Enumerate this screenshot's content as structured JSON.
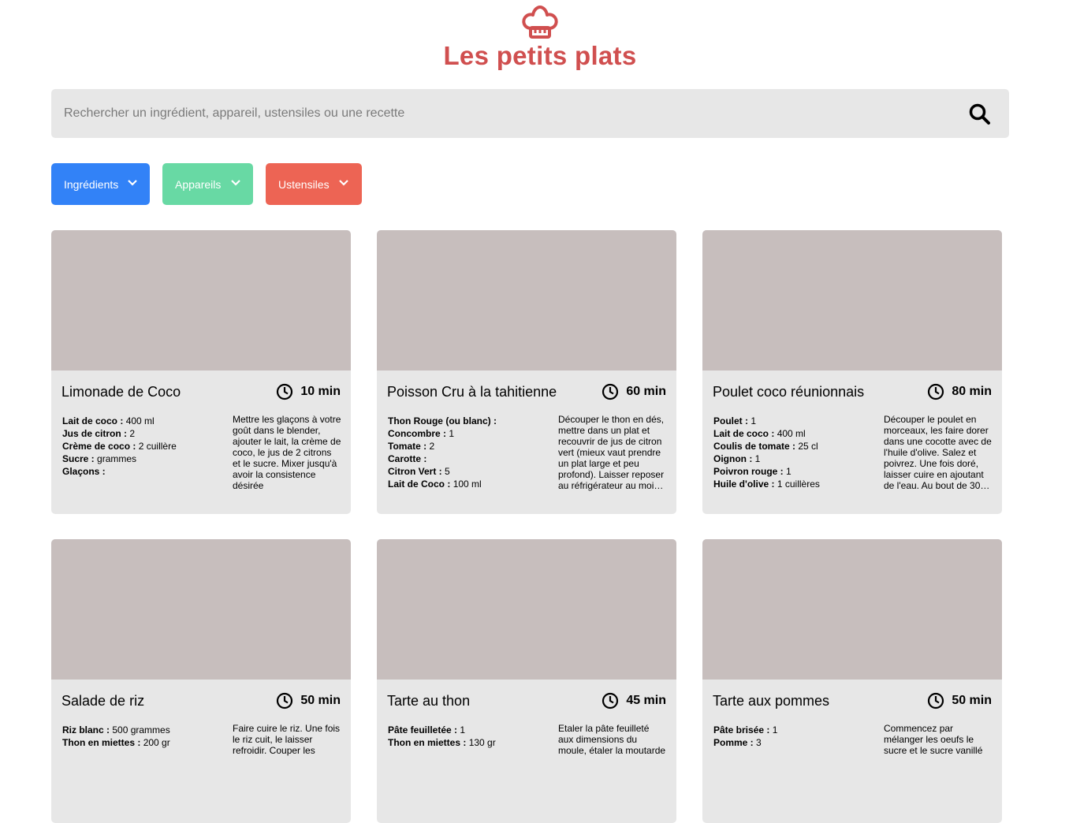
{
  "brand": {
    "name": "Les petits plats",
    "color": "#d04f4f",
    "logo_icon": "chef-hat-icon"
  },
  "search": {
    "placeholder": "Rechercher un ingrédient, appareil, ustensiles ou une recette",
    "value": "",
    "icon": "search-icon"
  },
  "filters": [
    {
      "label": "Ingrédients",
      "color": "#3282f7"
    },
    {
      "label": "Appareils",
      "color": "#68d9a4"
    },
    {
      "label": "Ustensiles",
      "color": "#ed6454"
    }
  ],
  "recipes": [
    {
      "name": "Limonade de Coco",
      "time": "10 min",
      "ingredients": [
        {
          "name": "Lait de coco :",
          "qty": "400 ml"
        },
        {
          "name": "Jus de citron :",
          "qty": "2"
        },
        {
          "name": "Crème de coco :",
          "qty": "2 cuillère"
        },
        {
          "name": "Sucre :",
          "qty": "grammes"
        },
        {
          "name": "Glaçons :",
          "qty": ""
        }
      ],
      "description": "Mettre les glaçons à votre goût dans le blender, ajouter le lait, la crème de coco, le jus de 2 citrons et le sucre. Mixer jusqu'à avoir la consistence désirée"
    },
    {
      "name": "Poisson Cru à la tahitienne",
      "time": "60 min",
      "ingredients": [
        {
          "name": "Thon Rouge (ou blanc) :",
          "qty": ""
        },
        {
          "name": "Concombre :",
          "qty": "1"
        },
        {
          "name": "Tomate :",
          "qty": "2"
        },
        {
          "name": "Carotte :",
          "qty": ""
        },
        {
          "name": "Citron Vert :",
          "qty": "5"
        },
        {
          "name": "Lait de Coco :",
          "qty": "100 ml"
        }
      ],
      "description": "Découper le thon en dés, mettre dans un plat et recouvrir de jus de citron vert (mieux vaut prendre un plat large et peu profond). Laisser reposer au réfrigérateur au moi…"
    },
    {
      "name": "Poulet coco réunionnais",
      "time": "80 min",
      "ingredients": [
        {
          "name": "Poulet :",
          "qty": "1"
        },
        {
          "name": "Lait de coco :",
          "qty": "400 ml"
        },
        {
          "name": "Coulis de tomate :",
          "qty": "25 cl"
        },
        {
          "name": "Oignon :",
          "qty": "1"
        },
        {
          "name": "Poivron rouge :",
          "qty": "1"
        },
        {
          "name": "Huile d'olive :",
          "qty": "1 cuillères"
        }
      ],
      "description": "Découper le poulet en morceaux, les faire dorer dans une cocotte avec de l'huile d'olive. Salez et poivrez. Une fois doré, laisser cuire en ajoutant de l'eau. Au bout de 30…"
    },
    {
      "name": "Salade de riz",
      "time": "50 min",
      "ingredients": [
        {
          "name": "Riz blanc :",
          "qty": "500 grammes"
        },
        {
          "name": "Thon en miettes :",
          "qty": "200 gr"
        }
      ],
      "description": "Faire cuire le riz. Une fois le riz cuit, le laisser refroidir. Couper les"
    },
    {
      "name": "Tarte au thon",
      "time": "45 min",
      "ingredients": [
        {
          "name": "Pâte feuilletée :",
          "qty": "1"
        },
        {
          "name": "Thon en miettes :",
          "qty": "130 gr"
        }
      ],
      "description": "Etaler la pâte feuilleté aux dimensions du moule, étaler la moutarde"
    },
    {
      "name": "Tarte aux pommes",
      "time": "50 min",
      "ingredients": [
        {
          "name": "Pâte brisée :",
          "qty": "1"
        },
        {
          "name": "Pomme :",
          "qty": "3"
        }
      ],
      "description": "Commencez par mélanger les oeufs le sucre et le sucre vanillé"
    }
  ]
}
